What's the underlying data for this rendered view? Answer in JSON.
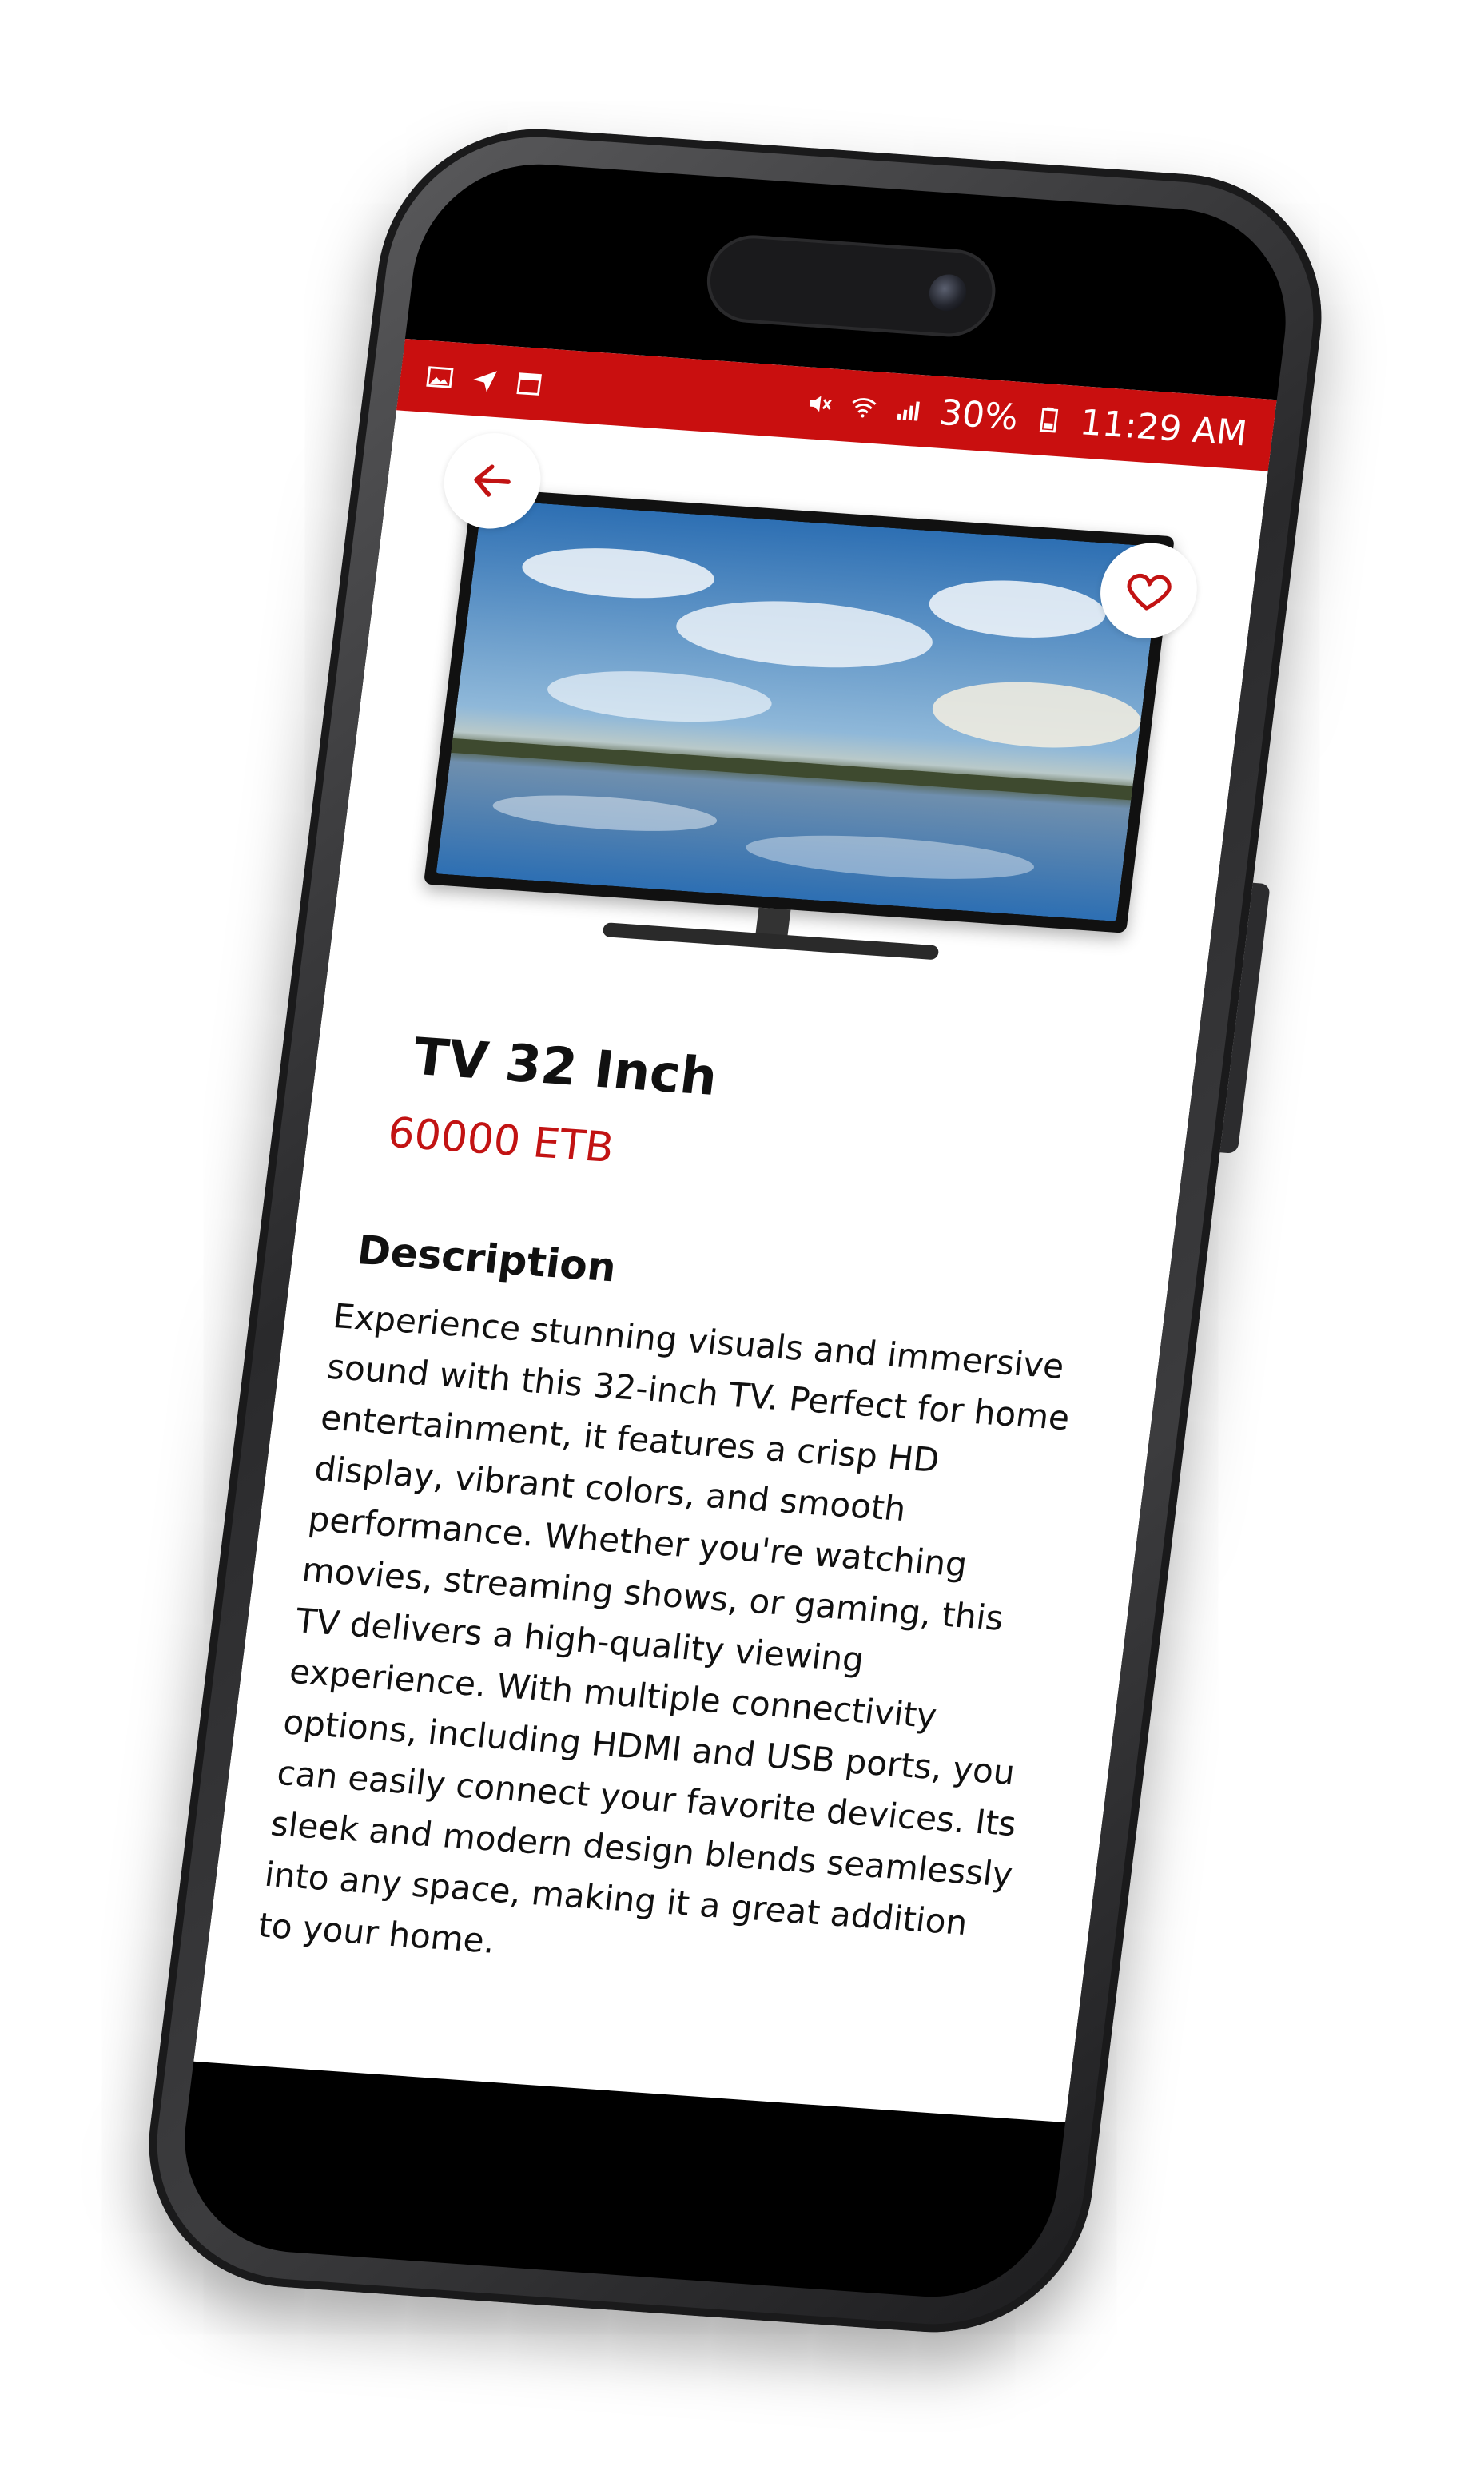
{
  "status_bar": {
    "battery": "30%",
    "time": "11:29 AM",
    "icons_left": [
      "image-icon",
      "send-icon",
      "calendar-icon"
    ],
    "icons_right": [
      "mute-icon",
      "wifi-icon",
      "signal-icon",
      "battery-icon"
    ]
  },
  "product": {
    "title": "TV 32 Inch",
    "price": "60000 ETB",
    "description_heading": "Description",
    "description": "Experience stunning visuals and immersive sound with this 32-inch TV. Perfect for home entertainment, it features a crisp HD display, vibrant colors, and smooth performance. Whether you're watching movies, streaming shows, or gaming, this TV delivers a high-quality viewing experience. With multiple connectivity options, including HDMI and USB ports, you can easily connect your favorite devices. Its sleek and modern design blends seamlessly into any space, making it a great addition to your home."
  },
  "colors": {
    "accent": "#c90f0f",
    "price": "#c21313",
    "background": "#ffffff"
  },
  "icons": {
    "back": "arrow-left-icon",
    "favorite": "heart-icon"
  }
}
